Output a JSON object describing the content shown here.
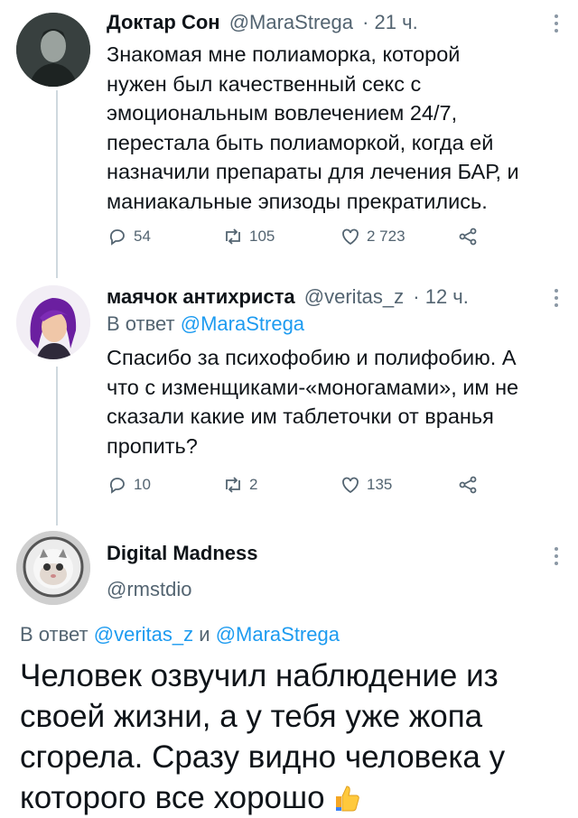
{
  "tweets": [
    {
      "name": "Доктар Сон",
      "handle": "@MaraStrega",
      "time": "· 21 ч.",
      "lines": [
        "Знакомая мне полиаморка, которой",
        "нужен был качественный секс с",
        "эмоциональным вовлечением 24/7,",
        "перестала быть полиаморкой, когда ей",
        "назначили препараты для лечения БАР, и",
        "маниакальные эпизоды прекратились."
      ],
      "replies": "54",
      "retweets": "105",
      "likes": "2 723"
    },
    {
      "name": "маячок антихриста",
      "handle": "@veritas_z",
      "time": "· 12 ч.",
      "reply_prefix": "В ответ",
      "reply_to": "@MaraStrega",
      "lines": [
        "Спасибо за психофобию и полифобию. А",
        "что с изменщиками-«моногамами», им не",
        "сказали какие им таблеточки от вранья",
        "пропить?"
      ],
      "replies": "10",
      "retweets": "2",
      "likes": "135"
    }
  ],
  "main_tweet": {
    "name": "Digital Madness",
    "handle": "@rmstdio",
    "reply_prefix": "В ответ",
    "reply_to_1": "@veritas_z",
    "reply_joiner": "и",
    "reply_to_2": "@MaraStrega",
    "lines": [
      "Человек озвучил наблюдение из",
      "своей жизни, а у тебя уже жопа",
      "сгорела. Сразу видно человека у",
      "которого все хорошо"
    ]
  },
  "colors": {
    "link": "#1d9bf0",
    "muted": "#536471",
    "text": "#0f1419",
    "thread_line": "#cfd9de"
  },
  "icons": [
    "reply-icon",
    "retweet-icon",
    "like-icon",
    "share-icon",
    "more-icon",
    "thumbs-up-icon"
  ]
}
